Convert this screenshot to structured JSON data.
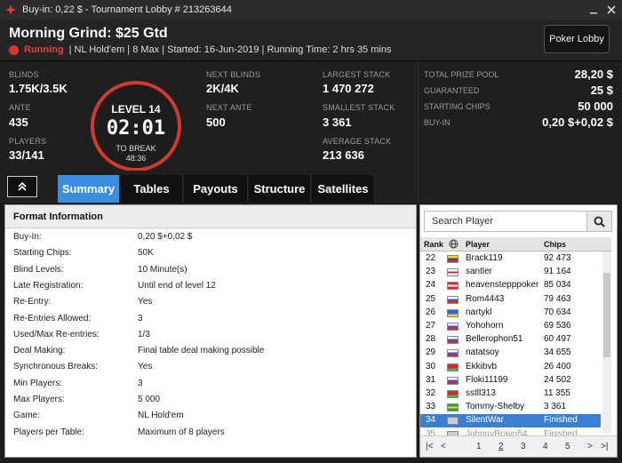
{
  "window": {
    "title": "Buy-in: 0,22 $ - Tournament Lobby # 213263644",
    "minimize_icon": "minimize-icon",
    "close_icon": "close-icon"
  },
  "header": {
    "tournament_name": "Morning Grind: $25 Gtd",
    "status": "Running",
    "details": "| NL Hold'em | 8 Max | Started: 16-Jun-2019 | Running Time: 2 hrs  35 mins",
    "lobby_button": "Poker Lobby"
  },
  "stats": {
    "blinds_label": "BLINDS",
    "blinds": "1.75K/3.5K",
    "ante_label": "ANTE",
    "ante": "435",
    "players_label": "PLAYERS",
    "players": "33/141",
    "level": "LEVEL 14",
    "clock": "02:01",
    "to_break_label": "TO BREAK",
    "to_break": "48:36",
    "next_blinds_label": "NEXT BLINDS",
    "next_blinds": "2K/4K",
    "next_ante_label": "NEXT ANTE",
    "next_ante": "500",
    "largest_label": "LARGEST STACK",
    "largest": "1 470 272",
    "smallest_label": "SMALLEST STACK",
    "smallest": "3 361",
    "average_label": "AVERAGE STACK",
    "average": "213 636"
  },
  "prize": [
    {
      "label": "TOTAL PRIZE POOL",
      "value": "28,20 $"
    },
    {
      "label": "GUARANTEED",
      "value": "25 $"
    },
    {
      "label": "STARTING CHIPS",
      "value": "50 000"
    },
    {
      "label": "BUY-IN",
      "value": "0,20 $+0,02 $"
    }
  ],
  "tabs": [
    "Summary",
    "Tables",
    "Payouts",
    "Structure",
    "Satellites"
  ],
  "format": {
    "heading": "Format Information",
    "rows": [
      {
        "k": "Buy-In:",
        "v": "0,20 $+0,02 $"
      },
      {
        "k": "Starting Chips:",
        "v": "50K"
      },
      {
        "k": "Blind Levels:",
        "v": "10 Minute(s)"
      },
      {
        "k": "Late Registration:",
        "v": "Until end of level 12"
      },
      {
        "k": "Re-Entry:",
        "v": "Yes"
      },
      {
        "k": "Re-Entries Allowed:",
        "v": "3"
      },
      {
        "k": "Used/Max Re-entries:",
        "v": "1/3"
      },
      {
        "k": "Deal Making:",
        "v": "Final table deal making possible"
      },
      {
        "k": "Synchronous Breaks:",
        "v": "Yes"
      },
      {
        "k": "Min Players:",
        "v": "3"
      },
      {
        "k": "Max Players:",
        "v": "5 000"
      },
      {
        "k": "Game:",
        "v": "NL Hold'em"
      },
      {
        "k": "Players per Table:",
        "v": "Maximum of 8 players"
      }
    ]
  },
  "players_panel": {
    "search_placeholder": "Search Player",
    "col_rank": "Rank",
    "col_player": "Player",
    "col_chips": "Chips",
    "rows": [
      {
        "rank": "22",
        "name": "Brack119",
        "chips": "92 473",
        "flag": [
          "#f2d230",
          "#1e4ea8",
          "#d82a2a"
        ]
      },
      {
        "rank": "23",
        "name": "santler",
        "chips": "91 164",
        "flag": [
          "#ffffff",
          "#d82a2a",
          "#ffffff"
        ]
      },
      {
        "rank": "24",
        "name": "heavenstepppoker",
        "chips": "85 034",
        "flag": [
          "#d82a2a",
          "#ffffff",
          "#d82a2a"
        ]
      },
      {
        "rank": "25",
        "name": "Rom4443",
        "chips": "79 463",
        "flag": [
          "#ffffff",
          "#2a5bd8",
          "#d82a2a"
        ]
      },
      {
        "rank": "26",
        "name": "nartykl",
        "chips": "70 634",
        "flag": [
          "#2a6ad8",
          "#2a6ad8",
          "#f2d230"
        ]
      },
      {
        "rank": "27",
        "name": "Yohohorn",
        "chips": "69 536",
        "flag": [
          "#ffffff",
          "#2a5bd8",
          "#d82a2a"
        ]
      },
      {
        "rank": "28",
        "name": "Bellerophon51",
        "chips": "60 497",
        "flag": [
          "#ffffff",
          "#2a5bd8",
          "#d82a2a"
        ]
      },
      {
        "rank": "29",
        "name": "natatsoy",
        "chips": "34 655",
        "flag": [
          "#ffffff",
          "#2a5bd8",
          "#d82a2a"
        ]
      },
      {
        "rank": "30",
        "name": "Ekkibvb",
        "chips": "26 400",
        "flag": [
          "#d82a2a",
          "#d82a2a",
          "#4caf50"
        ]
      },
      {
        "rank": "31",
        "name": "Floki11199",
        "chips": "24 502",
        "flag": [
          "#ffffff",
          "#2a5bd8",
          "#d82a2a"
        ]
      },
      {
        "rank": "32",
        "name": "sstll313",
        "chips": "11 355",
        "flag": [
          "#d82a2a",
          "#d82a2a",
          "#4caf50"
        ]
      },
      {
        "rank": "33",
        "name": "Tommy-Shelby",
        "chips": "3 361",
        "flag": [
          "#2e9e3e",
          "#f2d230",
          "#2e9e3e"
        ]
      },
      {
        "rank": "34",
        "name": "SilentWar",
        "chips": "Finished",
        "flag": [
          "#cccccc",
          "#cccccc",
          "#cccccc"
        ],
        "selected": true
      },
      {
        "rank": "35",
        "name": "JohnnyBravo54...",
        "chips": "Finished",
        "flag": [
          "#cccccc",
          "#cccccc",
          "#cccccc"
        ],
        "dim": true
      }
    ],
    "pages": [
      "1",
      "2",
      "3",
      "4",
      "5"
    ],
    "current_page": "2"
  },
  "colors": {
    "accent": "#3a8ee0",
    "running": "#e24040",
    "timer_ring": "#d33a2c"
  }
}
